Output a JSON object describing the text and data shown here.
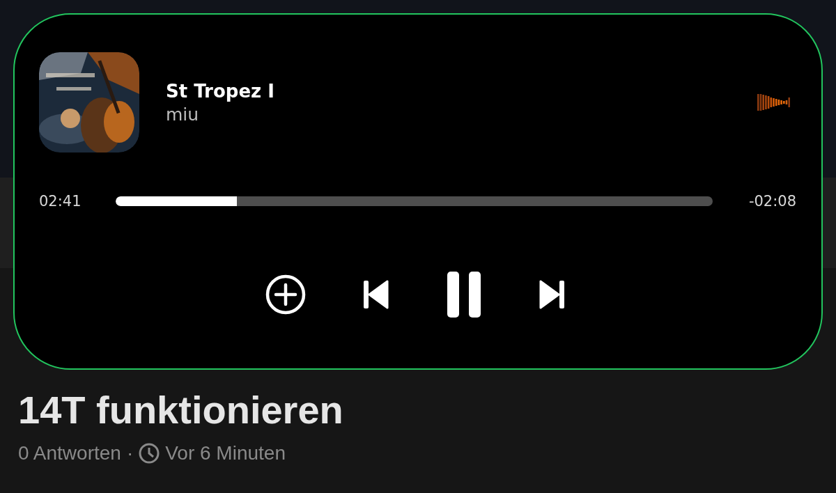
{
  "player": {
    "title": "St Tropez I",
    "artist": "miu",
    "elapsed": "02:41",
    "remaining": "-02:08",
    "progress": {
      "level": 0.203
    },
    "playing": true
  },
  "post": {
    "title_line": "14T funktionieren",
    "replies": "0 Antworten",
    "separator": "·",
    "time": "Vor 6 Minuten"
  }
}
